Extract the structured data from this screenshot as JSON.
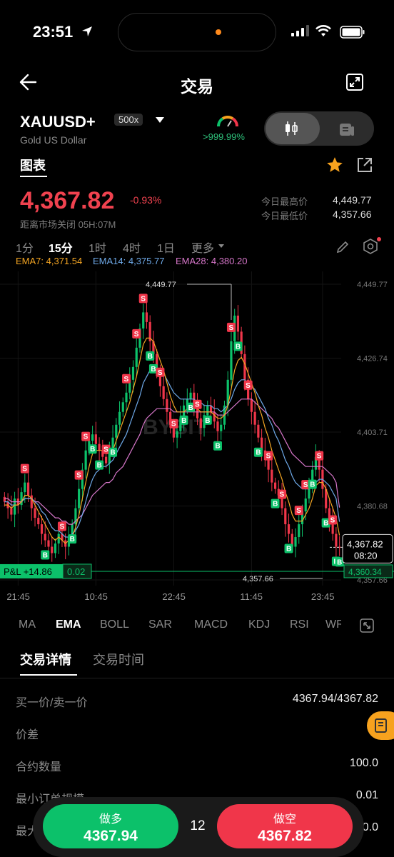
{
  "status": {
    "time": "23:51"
  },
  "nav": {
    "title": "交易"
  },
  "symbol": {
    "name": "XAUUSD+",
    "leverage": "500x",
    "subtitle": "Gold US Dollar",
    "gauge_text": ">999.99%"
  },
  "tabs": {
    "chart": "图表"
  },
  "price": {
    "current": "4,367.82",
    "change": "-0.93%",
    "market_status": "距离市场关闭 05H:07M",
    "high_label": "今日最高价",
    "high_value": "4,449.77",
    "low_label": "今日最低价",
    "low_value": "4,357.66"
  },
  "timeframes": [
    "1分",
    "15分",
    "1时",
    "4时",
    "1日",
    "更多"
  ],
  "ema": [
    {
      "text": "EMA7: 4,371.54",
      "color": "#f5a623"
    },
    {
      "text": "EMA14: 4,375.77",
      "color": "#6ea9e8"
    },
    {
      "text": "EMA28: 4,380.20",
      "color": "#d676c9"
    }
  ],
  "chart_data": {
    "type": "candlestick",
    "y_ticks": [
      "4,449.77",
      "4,426.74",
      "4,403.71",
      "4,380.68",
      "4,357.66"
    ],
    "x_ticks": [
      "21:45",
      "10:45",
      "22:45",
      "11:45",
      "23:45"
    ],
    "ylim": [
      4357.66,
      4449.77
    ],
    "high_label": "4,449.77",
    "low_label": "4,357.66",
    "current_price_tag": "4,367.82",
    "countdown": "08:20",
    "position_price": "4,360.34",
    "pnl_label": "P&L +14.86",
    "position_size": "0.02",
    "watermark": "BYBIT",
    "closes": [
      4382,
      4380,
      4378,
      4383,
      4381,
      4385,
      4388,
      4384,
      4380,
      4377,
      4375,
      4372,
      4370,
      4368,
      4366,
      4369,
      4372,
      4370,
      4368,
      4371,
      4375,
      4380,
      4386,
      4392,
      4398,
      4401,
      4403,
      4400,
      4398,
      4396,
      4394,
      4398,
      4402,
      4406,
      4410,
      4413,
      4416,
      4420,
      4424,
      4430,
      4436,
      4441,
      4438,
      4432,
      4428,
      4422,
      4418,
      4414,
      4410,
      4406,
      4402,
      4404,
      4408,
      4412,
      4414,
      4416,
      4412,
      4408,
      4405,
      4409,
      4412,
      4410,
      4407,
      4404,
      4406,
      4412,
      4420,
      4432,
      4440,
      4435,
      4428,
      4420,
      4414,
      4410,
      4406,
      4402,
      4398,
      4395,
      4392,
      4388,
      4386,
      4384,
      4380,
      4375,
      4372,
      4368,
      4371,
      4375,
      4379,
      4383,
      4388,
      4392,
      4396,
      4392,
      4386,
      4380,
      4376,
      4372,
      4368,
      4367.82
    ],
    "ema7": [
      4381,
      4381,
      4380,
      4381,
      4381,
      4382,
      4384,
      4384,
      4383,
      4381,
      4379,
      4377,
      4375,
      4373,
      4371,
      4370,
      4371,
      4370,
      4369,
      4370,
      4371,
      4374,
      4378,
      4383,
      4388,
      4393,
      4397,
      4398,
      4398,
      4398,
      4397,
      4397,
      4398,
      4401,
      4404,
      4407,
      4410,
      4413,
      4417,
      4421,
      4426,
      4431,
      4433,
      4433,
      4432,
      4429,
      4426,
      4423,
      4419,
      4415,
      4412,
      4410,
      4410,
      4410,
      4411,
      4412,
      4412,
      4411,
      4410,
      4410,
      4410,
      4410,
      4409,
      4408,
      4408,
      4409,
      4412,
      4417,
      4423,
      4426,
      4427,
      4425,
      4422,
      4419,
      4416,
      4412,
      4409,
      4405,
      4402,
      4398,
      4395,
      4392,
      4389,
      4385,
      4382,
      4378,
      4376,
      4376,
      4376,
      4378,
      4380,
      4383,
      4387,
      4388,
      4388,
      4386,
      4383,
      4380,
      4377,
      4371.54
    ],
    "ema14": [
      4382,
      4382,
      4381,
      4381,
      4381,
      4382,
      4383,
      4383,
      4383,
      4382,
      4381,
      4379,
      4378,
      4376,
      4374,
      4373,
      4373,
      4372,
      4371,
      4371,
      4372,
      4373,
      4375,
      4378,
      4382,
      4386,
      4389,
      4391,
      4392,
      4393,
      4393,
      4394,
      4395,
      4397,
      4399,
      4401,
      4403,
      4406,
      4409,
      4412,
      4415,
      4419,
      4421,
      4423,
      4423,
      4423,
      4423,
      4422,
      4420,
      4418,
      4416,
      4415,
      4414,
      4414,
      4414,
      4414,
      4414,
      4413,
      4413,
      4412,
      4412,
      4412,
      4411,
      4411,
      4410,
      4411,
      4412,
      4414,
      4417,
      4419,
      4420,
      4420,
      4419,
      4418,
      4417,
      4415,
      4413,
      4411,
      4408,
      4406,
      4403,
      4401,
      4398,
      4395,
      4393,
      4390,
      4388,
      4387,
      4386,
      4386,
      4386,
      4387,
      4388,
      4389,
      4389,
      4388,
      4387,
      4385,
      4383,
      4375.77
    ],
    "ema28": [
      4383,
      4383,
      4382,
      4382,
      4382,
      4382,
      4383,
      4383,
      4383,
      4382,
      4382,
      4381,
      4380,
      4379,
      4378,
      4377,
      4377,
      4376,
      4376,
      4375,
      4375,
      4376,
      4377,
      4378,
      4380,
      4382,
      4384,
      4385,
      4386,
      4387,
      4388,
      4388,
      4389,
      4391,
      4392,
      4393,
      4395,
      4397,
      4399,
      4401,
      4403,
      4406,
      4408,
      4409,
      4410,
      4411,
      4411,
      4411,
      4411,
      4411,
      4410,
      4410,
      4410,
      4410,
      4410,
      4410,
      4410,
      4410,
      4410,
      4410,
      4410,
      4410,
      4410,
      4409,
      4409,
      4409,
      4410,
      4411,
      4412,
      4413,
      4414,
      4414,
      4414,
      4414,
      4413,
      4412,
      4411,
      4410,
      4409,
      4408,
      4406,
      4405,
      4403,
      4401,
      4399,
      4397,
      4396,
      4395,
      4394,
      4393,
      4393,
      4393,
      4393,
      4393,
      4393,
      4392,
      4391,
      4390,
      4388,
      4380.2
    ],
    "markers": [
      {
        "i": 6,
        "side": "S"
      },
      {
        "i": 12,
        "side": "B"
      },
      {
        "i": 17,
        "side": "S"
      },
      {
        "i": 20,
        "side": "B"
      },
      {
        "i": 22,
        "side": "S"
      },
      {
        "i": 24,
        "side": "S"
      },
      {
        "i": 26,
        "side": "B"
      },
      {
        "i": 28,
        "side": "B"
      },
      {
        "i": 30,
        "side": "S"
      },
      {
        "i": 32,
        "side": "B"
      },
      {
        "i": 36,
        "side": "S"
      },
      {
        "i": 39,
        "side": "S"
      },
      {
        "i": 41,
        "side": "S"
      },
      {
        "i": 43,
        "side": "B"
      },
      {
        "i": 44,
        "side": "B"
      },
      {
        "i": 46,
        "side": "S"
      },
      {
        "i": 50,
        "side": "S"
      },
      {
        "i": 53,
        "side": "B"
      },
      {
        "i": 55,
        "side": "B"
      },
      {
        "i": 57,
        "side": "S"
      },
      {
        "i": 60,
        "side": "B"
      },
      {
        "i": 63,
        "side": "B"
      },
      {
        "i": 67,
        "side": "S"
      },
      {
        "i": 69,
        "side": "B"
      },
      {
        "i": 72,
        "side": "S"
      },
      {
        "i": 75,
        "side": "B"
      },
      {
        "i": 78,
        "side": "S"
      },
      {
        "i": 80,
        "side": "B"
      },
      {
        "i": 82,
        "side": "S"
      },
      {
        "i": 84,
        "side": "B"
      },
      {
        "i": 87,
        "side": "S"
      },
      {
        "i": 89,
        "side": "S"
      },
      {
        "i": 91,
        "side": "B"
      },
      {
        "i": 93,
        "side": "S"
      },
      {
        "i": 95,
        "side": "B"
      },
      {
        "i": 97,
        "side": "S"
      },
      {
        "i": 98,
        "side": "B"
      },
      {
        "i": 99,
        "side": "B"
      }
    ]
  },
  "indicators": [
    "MA",
    "EMA",
    "BOLL",
    "SAR",
    "MACD",
    "KDJ",
    "RSI",
    "WR"
  ],
  "detail_tabs": [
    "交易详情",
    "交易时间"
  ],
  "details": [
    {
      "label": "买一价/卖一价",
      "value": "4367.94/4367.82"
    },
    {
      "label": "价差",
      "value": ""
    },
    {
      "label": "合约数量",
      "value": "100.0"
    },
    {
      "label": "最小订单规模",
      "value": "0.01"
    },
    {
      "label": "最大",
      "value": "0.0"
    }
  ],
  "trade": {
    "buy_label": "做多",
    "buy_price": "4367.94",
    "quantity": "12",
    "sell_label": "做空",
    "sell_price": "4367.82"
  },
  "colors": {
    "up": "#0cc16a",
    "down": "#f0364a",
    "accent": "#f7a21e"
  }
}
